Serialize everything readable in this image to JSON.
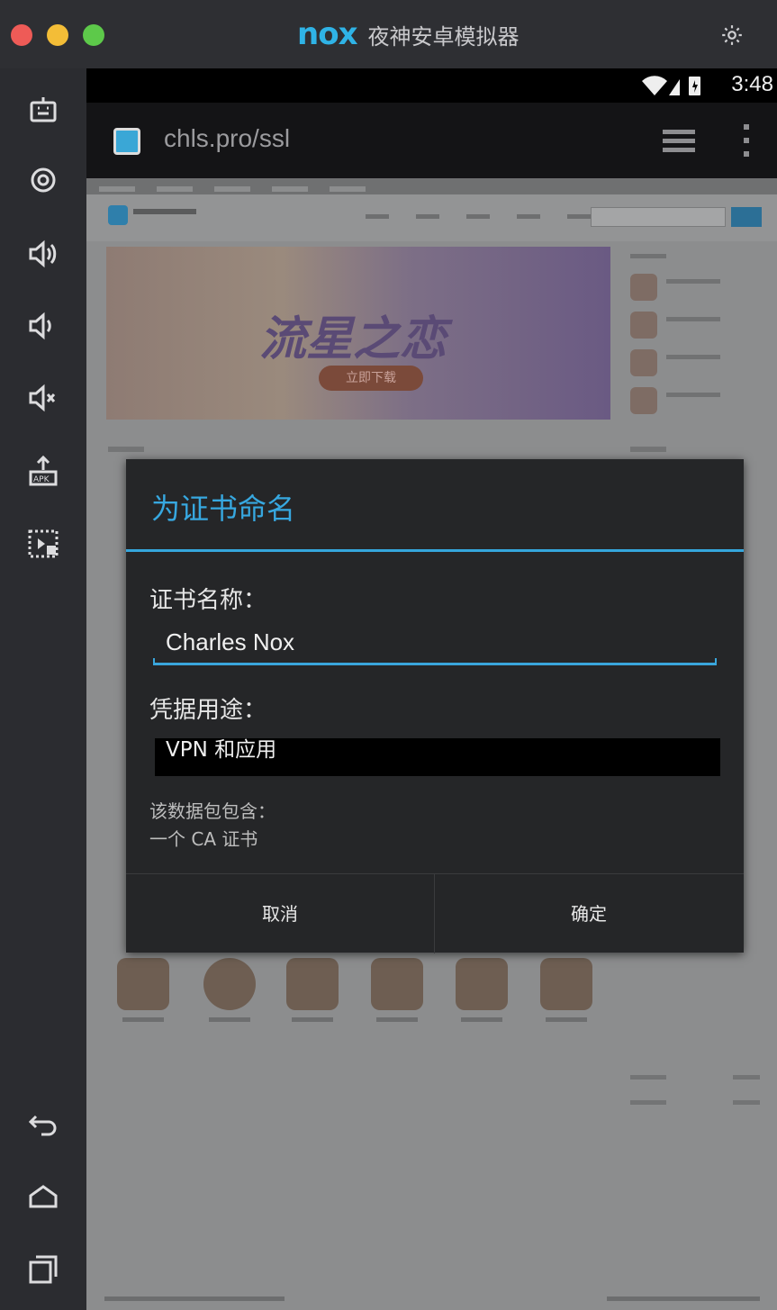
{
  "window": {
    "brand": "nox",
    "title": "夜神安卓模拟器"
  },
  "status_bar": {
    "time": "3:48"
  },
  "browser": {
    "url": "chls.pro/ssl"
  },
  "dialog": {
    "title": "为证书命名",
    "name_label": "证书名称：",
    "name_value": "Charles Nox",
    "usage_label": "凭据用途：",
    "usage_value": "VPN 和应用",
    "package_line1": "该数据包包含：",
    "package_line2": "一个 CA 证书",
    "cancel": "取消",
    "ok": "确定"
  },
  "background_page": {
    "banner_title": "流星之恋",
    "banner_button": "立即下载"
  },
  "colors": {
    "accent": "#35a6dc",
    "dialog_bg": "#252628",
    "frame_bg": "#2b2c30"
  },
  "sidebar_icons": [
    "toolbar-icon",
    "location-icon",
    "volume-up-icon",
    "volume-down-icon",
    "mute-icon",
    "apk-install-icon",
    "screen-record-icon",
    "back-icon",
    "home-icon",
    "recent-apps-icon"
  ]
}
